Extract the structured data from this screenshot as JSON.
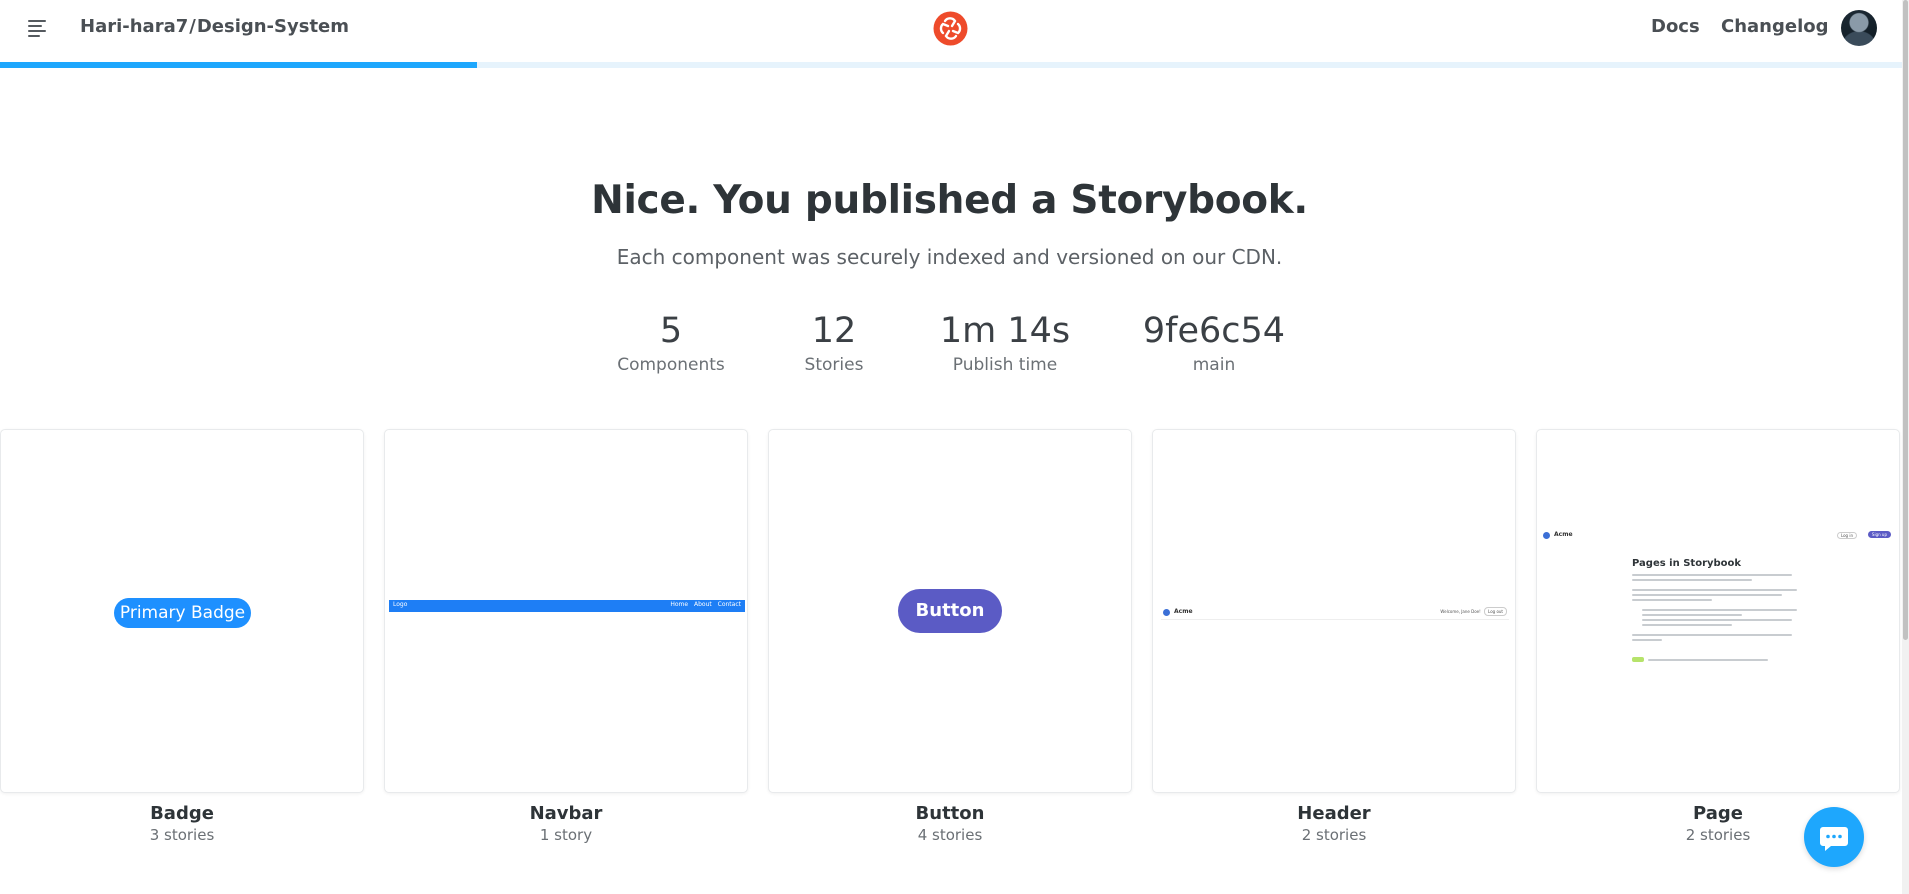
{
  "header": {
    "owner": "Hari-hara7",
    "separator": "/",
    "repo": "Design-System",
    "nav": [
      {
        "label": "Docs"
      },
      {
        "label": "Changelog"
      }
    ],
    "progress_fraction": 0.25,
    "progress_color": "#1ea7fd",
    "logo_color": "#ee4b2b",
    "icons": {
      "menu": "hamburger-menu-icon",
      "logo": "chromatic-logo-icon",
      "chat": "chat-bubble-icon"
    }
  },
  "hero": {
    "title": "Nice. You published a Storybook.",
    "subtitle": "Each component was securely indexed and versioned on our CDN."
  },
  "stats": [
    {
      "value": "5",
      "label": "Components"
    },
    {
      "value": "12",
      "label": "Stories"
    },
    {
      "value": "1m 14s",
      "label": "Publish time"
    },
    {
      "value": "9fe6c54",
      "label": "main"
    }
  ],
  "cards": [
    {
      "name": "Badge",
      "count": "3 stories",
      "preview_text": "Primary Badge"
    },
    {
      "name": "Navbar",
      "count": "1 story",
      "preview_logo": "Logo",
      "preview_links": "Home About Contact"
    },
    {
      "name": "Button",
      "count": "4 stories",
      "preview_text": "Button"
    },
    {
      "name": "Header",
      "count": "2 stories",
      "preview_brand": "Acme",
      "preview_welcome": "Welcome, Jane Doe!",
      "preview_logout": "Log out"
    },
    {
      "name": "Page",
      "count": "2 stories",
      "preview_brand": "Acme",
      "preview_login": "Log in",
      "preview_signup": "Sign up",
      "preview_heading": "Pages in Storybook"
    }
  ]
}
